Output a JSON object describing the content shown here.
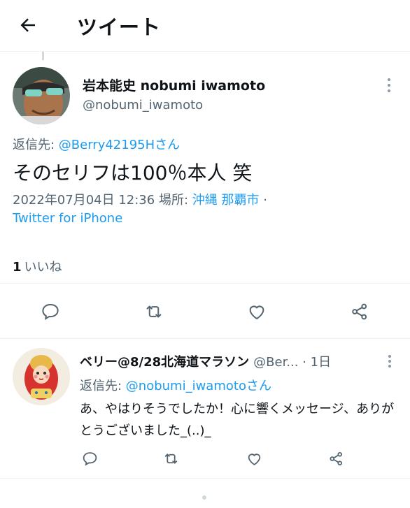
{
  "header": {
    "title": "ツイート",
    "back_icon": "arrow-left-icon"
  },
  "main_tweet": {
    "author_name": "岩本能史 nobumi iwamoto",
    "author_handle": "@nobumi_iwamoto",
    "reply_prefix": "返信先: ",
    "reply_to": "@Berry42195Hさん",
    "text": "そのセリフは100％本人 笑",
    "timestamp": "2022年07月04日 12:36",
    "location_label": " 場所: ",
    "location": "沖縄 那覇市",
    "separator": " ·",
    "source": "Twitter for iPhone",
    "likes_count": "1",
    "likes_label": "いいね"
  },
  "reply_tweet": {
    "author_name": "ベリー@8/28北海道マラソン",
    "author_handle": "@Ber...",
    "time": " · 1日",
    "reply_prefix": "返信先: ",
    "reply_to": "@nobumi_iwamotoさん",
    "text": "あ、やはりそうでしたか！心に響くメッセージ、ありがとうございました_(..)_"
  },
  "colors": {
    "accent": "#1d9bf0",
    "secondary_text": "#536471",
    "primary_text": "#0f1419",
    "divider": "#eff3f4"
  }
}
